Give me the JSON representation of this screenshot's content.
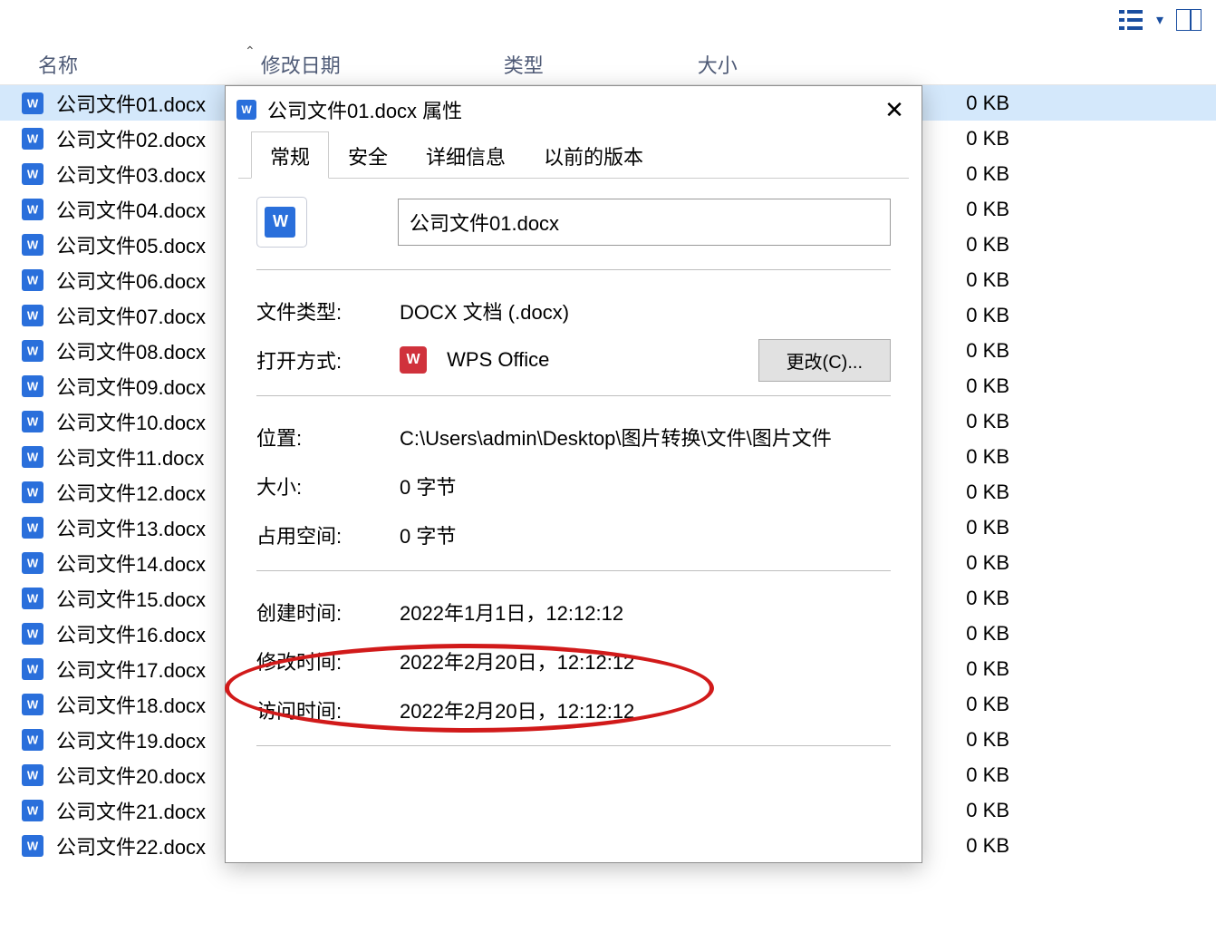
{
  "toolbar": {
    "view_icon": "view-list-icon",
    "dropdown": "▾"
  },
  "columns": {
    "name": "名称",
    "modified": "修改日期",
    "type": "类型",
    "size": "大小",
    "sort_caret": "⌃"
  },
  "files": [
    {
      "name": "公司文件01.docx",
      "size": "0 KB",
      "selected": true
    },
    {
      "name": "公司文件02.docx",
      "size": "0 KB"
    },
    {
      "name": "公司文件03.docx",
      "size": "0 KB"
    },
    {
      "name": "公司文件04.docx",
      "size": "0 KB"
    },
    {
      "name": "公司文件05.docx",
      "size": "0 KB"
    },
    {
      "name": "公司文件06.docx",
      "size": "0 KB"
    },
    {
      "name": "公司文件07.docx",
      "size": "0 KB"
    },
    {
      "name": "公司文件08.docx",
      "size": "0 KB"
    },
    {
      "name": "公司文件09.docx",
      "size": "0 KB"
    },
    {
      "name": "公司文件10.docx",
      "size": "0 KB"
    },
    {
      "name": "公司文件11.docx",
      "size": "0 KB"
    },
    {
      "name": "公司文件12.docx",
      "size": "0 KB"
    },
    {
      "name": "公司文件13.docx",
      "size": "0 KB"
    },
    {
      "name": "公司文件14.docx",
      "size": "0 KB"
    },
    {
      "name": "公司文件15.docx",
      "size": "0 KB"
    },
    {
      "name": "公司文件16.docx",
      "size": "0 KB"
    },
    {
      "name": "公司文件17.docx",
      "size": "0 KB"
    },
    {
      "name": "公司文件18.docx",
      "size": "0 KB"
    },
    {
      "name": "公司文件19.docx",
      "size": "0 KB"
    },
    {
      "name": "公司文件20.docx",
      "size": "0 KB"
    },
    {
      "name": "公司文件21.docx",
      "size": "0 KB"
    },
    {
      "name": "公司文件22.docx",
      "size": "0 KB"
    }
  ],
  "dialog": {
    "title": "公司文件01.docx 属性",
    "tabs": {
      "general": "常规",
      "security": "安全",
      "details": "详细信息",
      "previous_versions": "以前的版本"
    },
    "filename": "公司文件01.docx",
    "file_type_label": "文件类型:",
    "file_type_value": "DOCX 文档 (.docx)",
    "open_with_label": "打开方式:",
    "open_with_value": "WPS Office",
    "wps_badge": "W",
    "change_button": "更改(C)...",
    "location_label": "位置:",
    "location_value": "C:\\Users\\admin\\Desktop\\图片转换\\文件\\图片文件",
    "size_label": "大小:",
    "size_value": "0 字节",
    "size_on_disk_label": "占用空间:",
    "size_on_disk_value": "0 字节",
    "created_label": "创建时间:",
    "created_value": "2022年1月1日，12:12:12",
    "modified_label": "修改时间:",
    "modified_value": "2022年2月20日，12:12:12",
    "accessed_label": "访问时间:",
    "accessed_value": "2022年2月20日，12:12:12",
    "close_glyph": "✕"
  }
}
